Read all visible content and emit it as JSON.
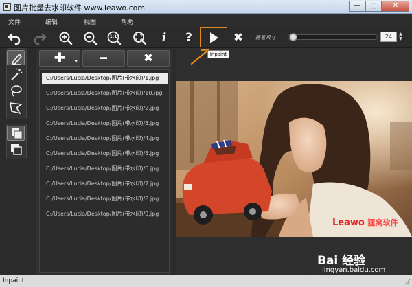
{
  "window": {
    "title": "图片批量去水印软件 www.leawo.com",
    "minimize_glyph": "—",
    "maximize_glyph": "□",
    "close_glyph": "✕"
  },
  "menu": [
    "文件",
    "编辑",
    "视图",
    "帮助"
  ],
  "toolbar": {
    "icons": [
      "undo-icon",
      "redo-icon",
      "zoom-in-icon",
      "zoom-out-icon",
      "actual-size-icon",
      "fit-window-icon",
      "info-icon",
      "help-icon",
      "play-icon",
      "stop-icon"
    ],
    "info_glyph": "i",
    "help_glyph": "?",
    "actual_size_glyph": "1:1",
    "stop_glyph": "✖",
    "brush_size_label": "画笔尺寸",
    "brush_size_value": "24",
    "brush_size_fraction": 0.02,
    "spin_up": "▲",
    "spin_down": "▼",
    "tooltip": "Inpaint"
  },
  "file_panel": {
    "add_glyph": "✚",
    "add_dropdown_glyph": "▾",
    "remove_glyph": "━",
    "clear_glyph": "✖",
    "files": [
      "C:/Users/Lucia/Desktop/图片(带水印)/1.jpg",
      "C:/Users/Lucia/Desktop/图片(带水印)/10.jpg",
      "C:/Users/Lucia/Desktop/图片(带水印)/2.jpg",
      "C:/Users/Lucia/Desktop/图片(带水印)/3.jpg",
      "C:/Users/Lucia/Desktop/图片(带水印)/4.jpg",
      "C:/Users/Lucia/Desktop/图片(带水印)/5.jpg",
      "C:/Users/Lucia/Desktop/图片(带水印)/6.jpg",
      "C:/Users/Lucia/Desktop/图片(带水印)/7.jpg",
      "C:/Users/Lucia/Desktop/图片(带水印)/8.jpg",
      "C:/Users/Lucia/Desktop/图片(带水印)/9.jpg"
    ],
    "selected_index": 0
  },
  "image": {
    "watermark_brand": "Leawo",
    "watermark_cn": "狸窝软件"
  },
  "overlay": {
    "baidu_logo": "Bai 经验",
    "baidu_url": "jingyan.baidu.com"
  },
  "status": {
    "text": "Inpaint"
  },
  "colors": {
    "accent_orange": "#e08a1e",
    "panel_dark": "#2b2b2b",
    "watermark_red": "#e02828"
  }
}
